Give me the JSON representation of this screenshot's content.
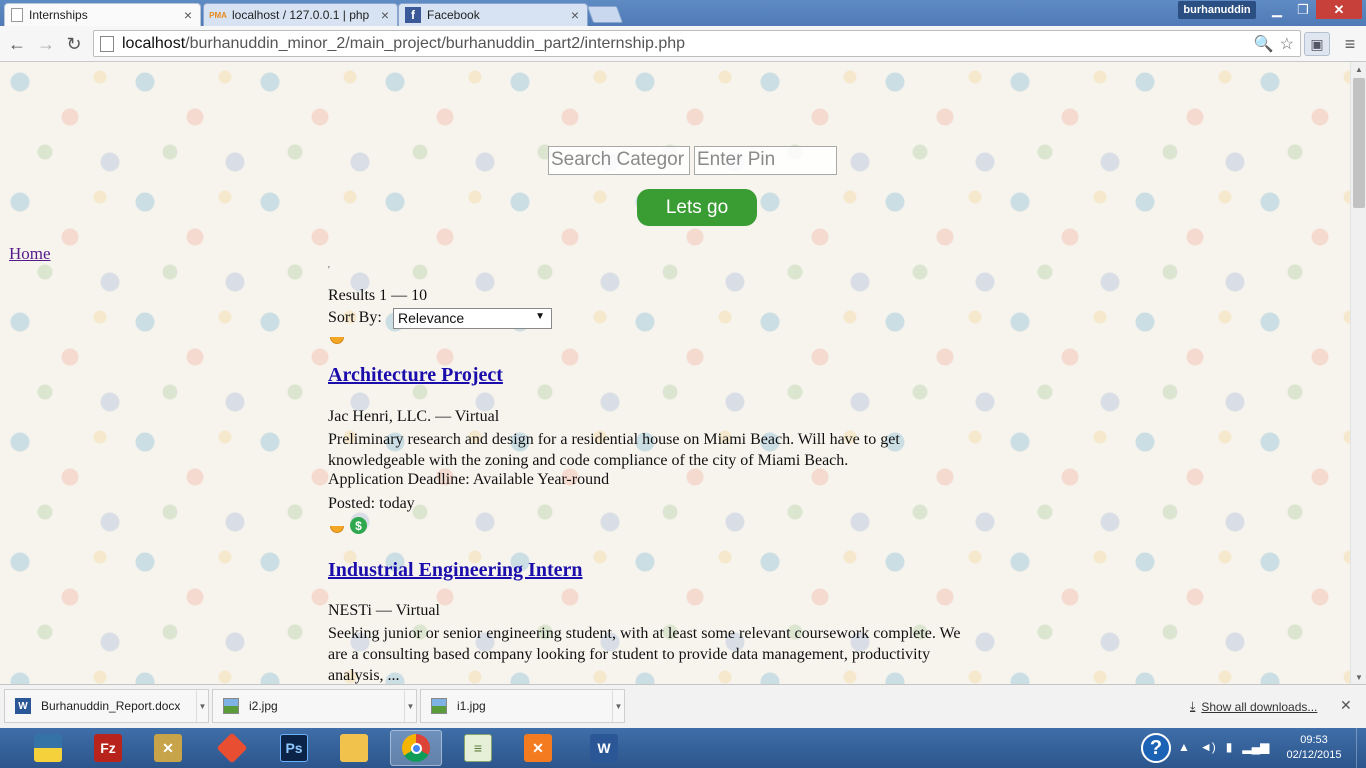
{
  "tabs": [
    {
      "label": "Internships",
      "favicon": "page-icon",
      "active": true
    },
    {
      "label": "localhost / 127.0.0.1 | php",
      "favicon": "phpmyadmin-icon",
      "active": false
    },
    {
      "label": "Facebook",
      "favicon": "facebook-icon",
      "active": false
    }
  ],
  "window": {
    "user": "burhanuddin"
  },
  "address_bar": {
    "host": "localhost",
    "path": "/burhanuddin_minor_2/main_project/burhanuddin_part2/internship.php"
  },
  "search": {
    "category_placeholder": "Search Categor",
    "pin_placeholder": "Enter Pin",
    "submit_label": "Lets go"
  },
  "nav": {
    "home_label": "Home"
  },
  "results": {
    "marker": "'",
    "range_label": "Results 1 — 10",
    "sort_label": "Sort By:",
    "sort_value": "Relevance"
  },
  "jobs": [
    {
      "title": "Architecture Project",
      "company_location": "Jac Henri, LLC. — Virtual",
      "description": "Preliminary research and design for a residential house on Miami Beach. Will have to get knowledgeable with the zoning and code compliance of the city of Miami Beach.",
      "deadline": "Application Deadline: Available Year-round",
      "posted": "Posted: today",
      "icons": [
        "half-circle-icon"
      ]
    },
    {
      "title": "Industrial Engineering Intern",
      "company_location": "NESTi — Virtual",
      "description": "Seeking junior or senior engineering student, with at least some relevant coursework complete. We are a consulting based company looking for student to provide data management, productivity analysis, ...",
      "icons": [
        "half-circle-icon",
        "dollar-icon"
      ]
    }
  ],
  "downloads": {
    "items": [
      {
        "name": "Burhanuddin_Report.docx",
        "icon": "word-doc-icon"
      },
      {
        "name": "i2.jpg",
        "icon": "image-file-icon"
      },
      {
        "name": "i1.jpg",
        "icon": "image-file-icon"
      }
    ],
    "show_all_label": "Show all downloads..."
  },
  "taskbar": {
    "apps": [
      "python-icon",
      "filezilla-icon",
      "tools-icon",
      "git-icon",
      "photoshop-icon",
      "file-explorer-icon",
      "chrome-icon",
      "notepad-icon",
      "xampp-icon",
      "word-icon"
    ],
    "time": "09:53",
    "date": "02/12/2015"
  },
  "colors": {
    "title_bar": "#4f7ab6",
    "go_button": "#3a9d34",
    "link": "#1a0dab",
    "visited_link": "#551a8b",
    "taskbar": "#2c558c"
  }
}
